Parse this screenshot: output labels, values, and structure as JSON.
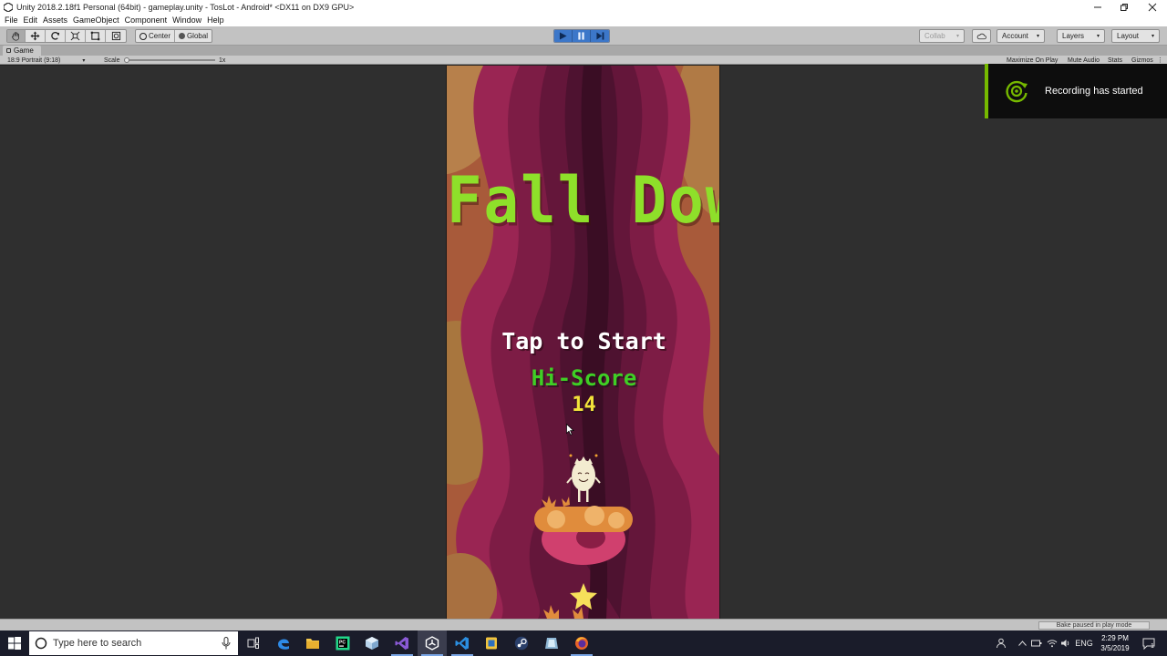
{
  "window": {
    "title": "Unity 2018.2.18f1 Personal (64bit) - gameplay.unity - TosLot - Android* <DX11 on DX9 GPU>",
    "controls": [
      "minimize-icon",
      "restore-icon",
      "close-icon"
    ]
  },
  "menubar": {
    "items": [
      "File",
      "Edit",
      "Assets",
      "GameObject",
      "Component",
      "Window",
      "Help"
    ]
  },
  "toolbar": {
    "tools": [
      "hand-tool-icon",
      "move-tool-icon",
      "rotate-tool-icon",
      "scale-tool-icon",
      "rect-tool-icon",
      "transform-tool-icon"
    ],
    "pivot_label": "Center",
    "space_label": "Global",
    "collab_label": "Collab",
    "account_label": "Account",
    "layers_label": "Layers",
    "layout_label": "Layout",
    "play_state": "playing",
    "accent_color": "#3c77c9"
  },
  "game_view": {
    "tab_label": "Game",
    "aspect_label": "18:9 Portrait (9:18)",
    "scale_label": "Scale",
    "scale_value": "1x",
    "options": [
      "Maximize On Play",
      "Mute Audio",
      "Stats",
      "Gizmos"
    ]
  },
  "game": {
    "title": "Fall Down",
    "tap_prompt": "Tap to Start",
    "hiscore_label": "Hi-Score",
    "hiscore_value": "14",
    "title_color": "#8ee02a",
    "hiscore_color": "#3fcf25",
    "value_color": "#f2e23a"
  },
  "notification": {
    "text": "Recording has started",
    "accent_color": "#76b900"
  },
  "statusbar": {
    "message": "Bake paused in play mode"
  },
  "taskbar": {
    "search_placeholder": "Type here to search",
    "apps": [
      "task-view-icon",
      "edge-icon",
      "file-explorer-icon",
      "pycharm-icon",
      "unity-box-icon",
      "visual-studio-icon",
      "unity-icon",
      "vscode-icon",
      "notepad-icon",
      "steam-icon",
      "app-icon",
      "firefox-icon"
    ],
    "language": "ENG",
    "time": "2:29 PM",
    "date": "3/5/2019",
    "notification_count": "1"
  }
}
